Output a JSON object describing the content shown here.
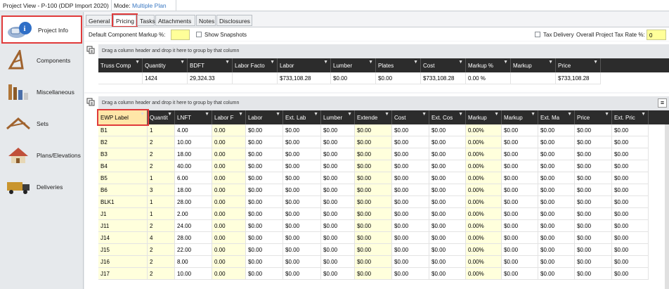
{
  "title": "Project View - P-100 (DDP Import 2020)",
  "mode_label": "Mode:",
  "mode_value": "Multiple Plan",
  "sidebar": [
    {
      "label": "Project Info",
      "icon": "project-info-icon",
      "active": true
    },
    {
      "label": "Components",
      "icon": "components-icon",
      "active": false
    },
    {
      "label": "Miscellaneous",
      "icon": "miscellaneous-icon",
      "active": false
    },
    {
      "label": "Sets",
      "icon": "sets-icon",
      "active": false
    },
    {
      "label": "Plans/Elevations",
      "icon": "plans-elevations-icon",
      "active": false
    },
    {
      "label": "Deliveries",
      "icon": "deliveries-icon",
      "active": false
    }
  ],
  "tabs": [
    "General",
    "Pricing",
    "Tasks",
    "Attachments",
    "Notes",
    "Disclosures"
  ],
  "active_tab": "Pricing",
  "options": {
    "markup_label": "Default Component Markup %:",
    "markup_value": "",
    "show_snapshots": "Show Snapshots",
    "tax_delivery": "Tax Delivery",
    "tax_rate_label": "Overall Project Tax Rate %:",
    "tax_rate_value": "0"
  },
  "group_hint": "Drag a column header and drop it here to group by that column",
  "summary_grid": {
    "columns": [
      "Truss Comp",
      "Quantity",
      "BDFT",
      "Labor Facto",
      "Labor",
      "Lumber",
      "Plates",
      "Cost",
      "Markup %",
      "Markup",
      "Price"
    ],
    "rows": [
      [
        "",
        "1424",
        "29,324.33",
        "",
        "$733,108.28",
        "$0.00",
        "$0.00",
        "$733,108.28",
        "0.00 %",
        "",
        "$733,108.28"
      ]
    ]
  },
  "ewp_grid": {
    "columns": [
      "EWP Label",
      "Quantit",
      "LNFT",
      "Labor F",
      "Labor",
      "Ext. Lab",
      "Lumber",
      "Extende",
      "Cost",
      "Ext. Cos",
      "Markup",
      "Markup",
      "Ext. Ma",
      "Price",
      "Ext. Pric"
    ],
    "rows": [
      [
        "B1",
        "1",
        "4.00",
        "0.00",
        "$0.00",
        "$0.00",
        "$0.00",
        "$0.00",
        "$0.00",
        "$0.00",
        "0.00%",
        "$0.00",
        "$0.00",
        "$0.00",
        "$0.00"
      ],
      [
        "B2",
        "2",
        "10.00",
        "0.00",
        "$0.00",
        "$0.00",
        "$0.00",
        "$0.00",
        "$0.00",
        "$0.00",
        "0.00%",
        "$0.00",
        "$0.00",
        "$0.00",
        "$0.00"
      ],
      [
        "B3",
        "2",
        "18.00",
        "0.00",
        "$0.00",
        "$0.00",
        "$0.00",
        "$0.00",
        "$0.00",
        "$0.00",
        "0.00%",
        "$0.00",
        "$0.00",
        "$0.00",
        "$0.00"
      ],
      [
        "B4",
        "2",
        "40.00",
        "0.00",
        "$0.00",
        "$0.00",
        "$0.00",
        "$0.00",
        "$0.00",
        "$0.00",
        "0.00%",
        "$0.00",
        "$0.00",
        "$0.00",
        "$0.00"
      ],
      [
        "B5",
        "1",
        "6.00",
        "0.00",
        "$0.00",
        "$0.00",
        "$0.00",
        "$0.00",
        "$0.00",
        "$0.00",
        "0.00%",
        "$0.00",
        "$0.00",
        "$0.00",
        "$0.00"
      ],
      [
        "B6",
        "3",
        "18.00",
        "0.00",
        "$0.00",
        "$0.00",
        "$0.00",
        "$0.00",
        "$0.00",
        "$0.00",
        "0.00%",
        "$0.00",
        "$0.00",
        "$0.00",
        "$0.00"
      ],
      [
        "BLK1",
        "1",
        "28.00",
        "0.00",
        "$0.00",
        "$0.00",
        "$0.00",
        "$0.00",
        "$0.00",
        "$0.00",
        "0.00%",
        "$0.00",
        "$0.00",
        "$0.00",
        "$0.00"
      ],
      [
        "J1",
        "1",
        "2.00",
        "0.00",
        "$0.00",
        "$0.00",
        "$0.00",
        "$0.00",
        "$0.00",
        "$0.00",
        "0.00%",
        "$0.00",
        "$0.00",
        "$0.00",
        "$0.00"
      ],
      [
        "J11",
        "2",
        "24.00",
        "0.00",
        "$0.00",
        "$0.00",
        "$0.00",
        "$0.00",
        "$0.00",
        "$0.00",
        "0.00%",
        "$0.00",
        "$0.00",
        "$0.00",
        "$0.00"
      ],
      [
        "J14",
        "4",
        "28.00",
        "0.00",
        "$0.00",
        "$0.00",
        "$0.00",
        "$0.00",
        "$0.00",
        "$0.00",
        "0.00%",
        "$0.00",
        "$0.00",
        "$0.00",
        "$0.00"
      ],
      [
        "J15",
        "2",
        "22.00",
        "0.00",
        "$0.00",
        "$0.00",
        "$0.00",
        "$0.00",
        "$0.00",
        "$0.00",
        "0.00%",
        "$0.00",
        "$0.00",
        "$0.00",
        "$0.00"
      ],
      [
        "J16",
        "2",
        "8.00",
        "0.00",
        "$0.00",
        "$0.00",
        "$0.00",
        "$0.00",
        "$0.00",
        "$0.00",
        "0.00%",
        "$0.00",
        "$0.00",
        "$0.00",
        "$0.00"
      ],
      [
        "J17",
        "2",
        "10.00",
        "0.00",
        "$0.00",
        "$0.00",
        "$0.00",
        "$0.00",
        "$0.00",
        "$0.00",
        "0.00%",
        "$0.00",
        "$0.00",
        "$0.00",
        "$0.00"
      ]
    ]
  },
  "colors": {
    "highlight": "#e03a3a",
    "header_bg": "#2c2c2c",
    "editable_cell": "#ffffdc",
    "mode_value": "#3a78c2"
  }
}
